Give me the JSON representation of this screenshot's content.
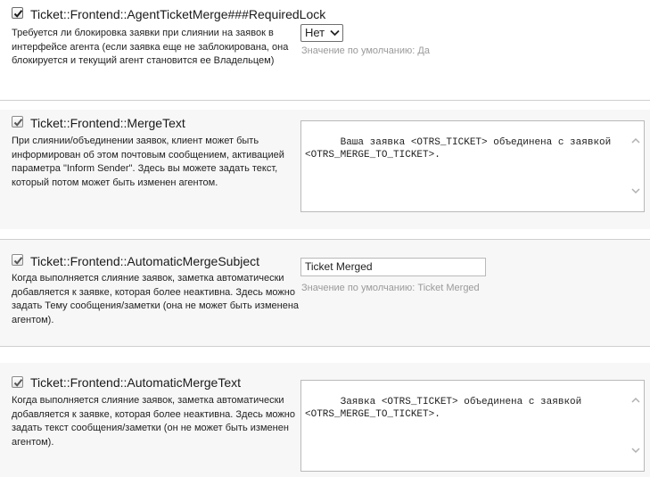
{
  "settings": [
    {
      "title": "Ticket::Frontend::AgentTicketMerge###RequiredLock",
      "description": "Требуется ли блокировка заявки при слиянии на заявок в интерфейсе агента (если заявка еще не заблокирована, она блокируется и текущий агент становится ее Владельцем)",
      "enabled": true,
      "control_value": "Нет",
      "default_note": "Значение по умолчанию: Да"
    },
    {
      "title": "Ticket::Frontend::MergeText",
      "description": "При слиянии/объединении заявок, клиент может быть информирован об этом почтовым сообщением, активацией параметра \"Inform Sender\". Здесь вы можете задать текст, который потом может быть изменен агентом.",
      "enabled": true,
      "control_value": "Ваша заявка <OTRS_TICKET> объединена с заявкой\n<OTRS_MERGE_TO_TICKET>."
    },
    {
      "title": "Ticket::Frontend::AutomaticMergeSubject",
      "description": "Когда выполняется слияние заявок, заметка автоматически добавляется к заявке, которая более неактивна. Здесь можно задать Тему сообщения/заметки (она не может быть изменена агентом).",
      "enabled": true,
      "control_value": "Ticket Merged",
      "default_note": "Значение по умолчанию: Ticket Merged"
    },
    {
      "title": "Ticket::Frontend::AutomaticMergeText",
      "description": "Когда выполняется слияние заявок, заметка автоматически добавляется к заявке, которая более неактивна. Здесь можно задать текст сообщения/заметки (он не может быть изменен агентом).",
      "enabled": true,
      "control_value": "Заявка <OTRS_TICKET> объединена с заявкой\n<OTRS_MERGE_TO_TICKET>."
    }
  ]
}
